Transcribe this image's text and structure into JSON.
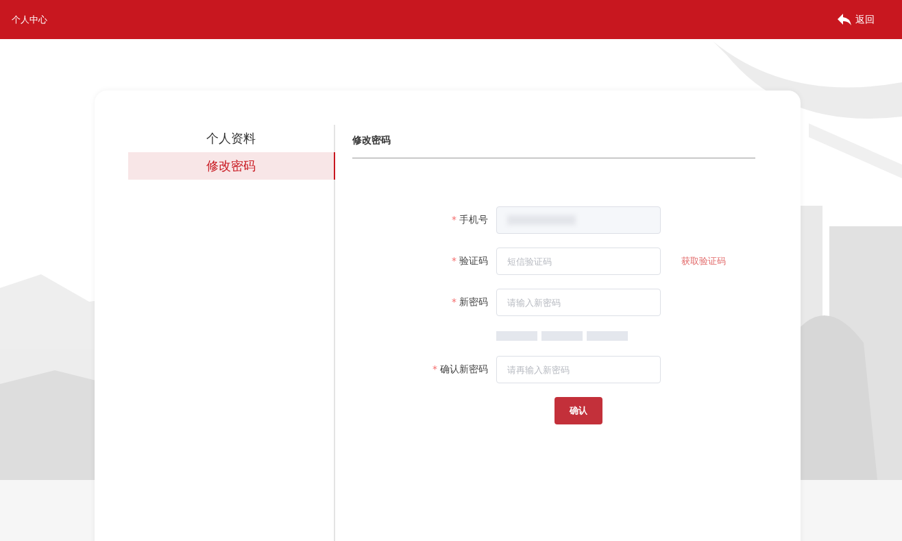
{
  "header": {
    "title": "个人中心",
    "back": "返回"
  },
  "sidebar": {
    "items": [
      {
        "label": "个人资料",
        "selected": false
      },
      {
        "label": "修改密码",
        "selected": true
      }
    ]
  },
  "section_title": "修改密码",
  "form": {
    "fields": [
      {
        "label": "手机号",
        "required_mark": "*",
        "disabled": true,
        "kind": "blurred"
      },
      {
        "label": "验证码",
        "required_mark": "*",
        "kind": "input",
        "placeholder": "短信验证码",
        "link": "获取验证码"
      },
      {
        "label": "新密码",
        "required_mark": "*",
        "kind": "input",
        "placeholder": "请输入新密码"
      },
      {
        "kind": "strength",
        "bars": [
          {
            "filled": false
          },
          {
            "filled": false
          },
          {
            "filled": false
          }
        ]
      },
      {
        "label": "确认新密码",
        "required_mark": "*",
        "kind": "input",
        "placeholder": "请再输入新密码"
      }
    ],
    "submit": "确认"
  }
}
